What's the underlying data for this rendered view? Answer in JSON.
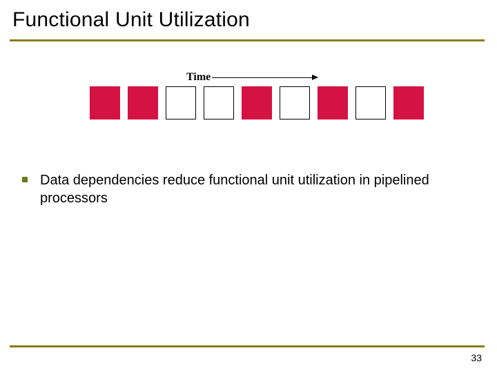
{
  "title": "Functional Unit Utilization",
  "timeLabel": "Time",
  "boxes": {
    "count": 9,
    "filled": [
      true,
      true,
      false,
      false,
      true,
      false,
      true,
      false,
      true
    ]
  },
  "bullet": "Data dependencies reduce functional unit utilization in pipelined processors",
  "pageNumber": "33",
  "colors": {
    "accentRule": "#8a7a1a",
    "bulletMarker": "#6a7a1a",
    "filledBox": "#d51244"
  }
}
